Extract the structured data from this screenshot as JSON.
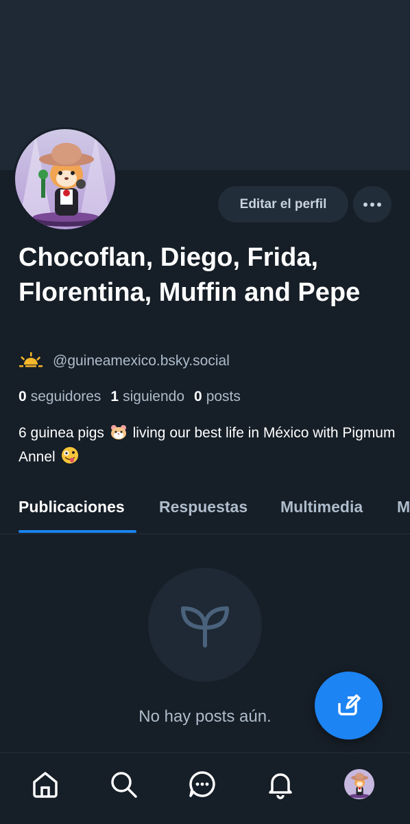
{
  "profile": {
    "display_name": "Chocoflan, Diego, Frida, Florentina, Muffin and Pepe",
    "handle_emoji": "🌅",
    "handle": "@guineamexico.bsky.social",
    "followers_count": "0",
    "followers_label": "seguidores",
    "following_count": "1",
    "following_label": "siguiendo",
    "posts_count": "0",
    "posts_label": "posts",
    "bio_part1": "6 guinea pigs",
    "bio_part2": "living our best life in México with Pigmum Annel"
  },
  "actions": {
    "edit_label": "Editar el perfil"
  },
  "tabs": [
    {
      "label": "Publicaciones",
      "active": true
    },
    {
      "label": "Respuestas",
      "active": false
    },
    {
      "label": "Multimedia",
      "active": false
    },
    {
      "label": "M",
      "active": false
    }
  ],
  "feed": {
    "empty_text": "No hay posts aún."
  },
  "nav": [
    {
      "icon": "home-icon"
    },
    {
      "icon": "search-icon"
    },
    {
      "icon": "chat-icon"
    },
    {
      "icon": "bell-icon"
    },
    {
      "icon": "profile-avatar"
    }
  ],
  "colors": {
    "background": "#161e27",
    "banner": "#1e2935",
    "accent": "#1a84f0",
    "muted_text": "#aebccb"
  }
}
